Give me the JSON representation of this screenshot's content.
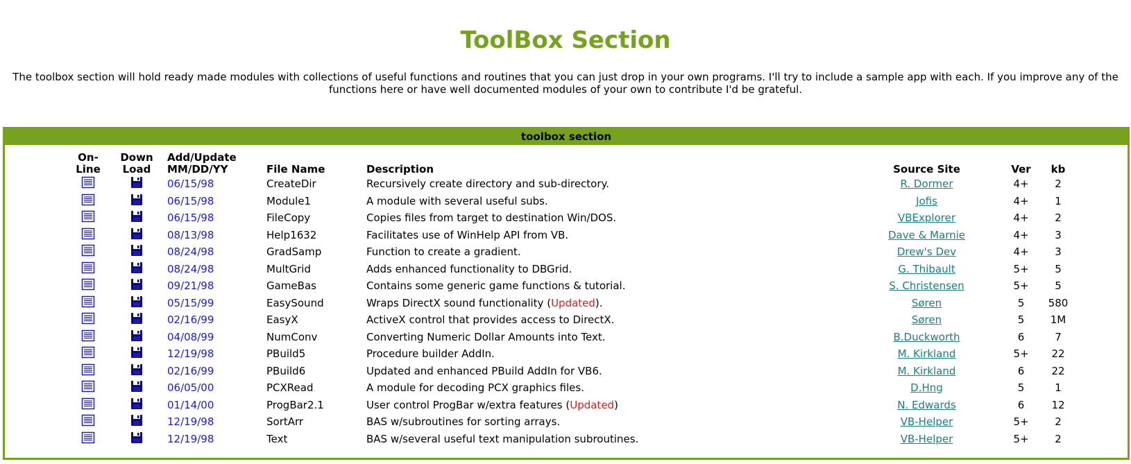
{
  "page": {
    "title": "ToolBox Section",
    "intro": "The toolbox section will hold ready made modules with collections of useful functions and routines that you can just drop in your own programs. I'll try to include a sample app with each. If you improve any of the functions here or have well documented modules of your own to contribute I'd be grateful."
  },
  "panel": {
    "header": "toolbox section"
  },
  "columns": {
    "online": [
      "On-",
      "Line"
    ],
    "download": [
      "Down",
      "Load"
    ],
    "date": [
      "Add/Update",
      "MM/DD/YY"
    ],
    "file": "File Name",
    "description": "Description",
    "source": "Source Site",
    "ver": "Ver",
    "kb": "kb"
  },
  "icons": {
    "online": "document-icon",
    "download": "floppy-disk-icon"
  },
  "colors": {
    "accent": "#76a21e",
    "date": "#1a1ad8",
    "link": "#1a8080",
    "updated": "#e11b1b"
  },
  "rows": [
    {
      "date": "06/15/98",
      "file": "CreateDir",
      "desc": "Recursively create directory and sub-directory.",
      "source": "R. Dormer",
      "ver": "4+",
      "kb": "2"
    },
    {
      "date": "06/15/98",
      "file": "Module1",
      "desc": "A module with several useful subs.",
      "source": "Jofis",
      "ver": "4+",
      "kb": "1"
    },
    {
      "date": "06/15/98",
      "file": "FileCopy",
      "desc": "Copies files from target to destination Win/DOS.",
      "source": "VBExplorer",
      "ver": "4+",
      "kb": "2"
    },
    {
      "date": "08/13/98",
      "file": "Help1632",
      "desc": "Facilitates use of WinHelp API from VB.",
      "source": "Dave & Marnie",
      "ver": "4+",
      "kb": "3"
    },
    {
      "date": "08/24/98",
      "file": "GradSamp",
      "desc": "Function to create a gradient.",
      "source": "Drew's Dev",
      "ver": "4+",
      "kb": "3"
    },
    {
      "date": "08/24/98",
      "file": "MultGrid",
      "desc": "Adds enhanced functionality to DBGrid.",
      "source": "G. Thibault",
      "ver": "5+",
      "kb": "5"
    },
    {
      "date": "09/21/98",
      "file": "GameBas",
      "desc": "Contains some generic game functions & tutorial.",
      "source": "S. Christensen",
      "ver": "5+",
      "kb": "5"
    },
    {
      "date": "05/15/99",
      "file": "EasySound",
      "desc": "Wraps DirectX sound functionality (",
      "desc_updated": "Updated",
      "desc_after": ").",
      "source": "Søren",
      "ver": "5",
      "kb": "580"
    },
    {
      "date": "02/16/99",
      "file": "EasyX",
      "desc": "ActiveX control that provides access to DirectX.",
      "source": "Søren",
      "ver": "5",
      "kb": "1M"
    },
    {
      "date": "04/08/99",
      "file": "NumConv",
      "desc": "Converting Numeric Dollar Amounts into Text.",
      "source": "B.Duckworth",
      "ver": "6",
      "kb": "7"
    },
    {
      "date": "12/19/98",
      "file": "PBuild5",
      "desc": "Procedure builder AddIn.",
      "source": "M. Kirkland",
      "ver": "5+",
      "kb": "22"
    },
    {
      "date": "02/16/99",
      "file": "PBuild6",
      "desc": "Updated and enhanced PBuild AddIn for VB6.",
      "source": "M. Kirkland",
      "ver": "6",
      "kb": "22"
    },
    {
      "date": "06/05/00",
      "file": "PCXRead",
      "desc": "A module for decoding PCX graphics files.",
      "source": "D.Hng",
      "ver": "5",
      "kb": "1"
    },
    {
      "date": "01/14/00",
      "file": "ProgBar2.1",
      "desc": "User control ProgBar w/extra features (",
      "desc_updated": "Updated",
      "desc_after": ")",
      "source": "N. Edwards",
      "ver": "6",
      "kb": "12"
    },
    {
      "date": "12/19/98",
      "file": "SortArr",
      "desc": "BAS w/subroutines for sorting arrays.",
      "source": "VB-Helper",
      "ver": "5+",
      "kb": "2"
    },
    {
      "date": "12/19/98",
      "file": "Text",
      "desc": "BAS w/several useful text manipulation subroutines.",
      "source": "VB-Helper",
      "ver": "5+",
      "kb": "2"
    }
  ]
}
